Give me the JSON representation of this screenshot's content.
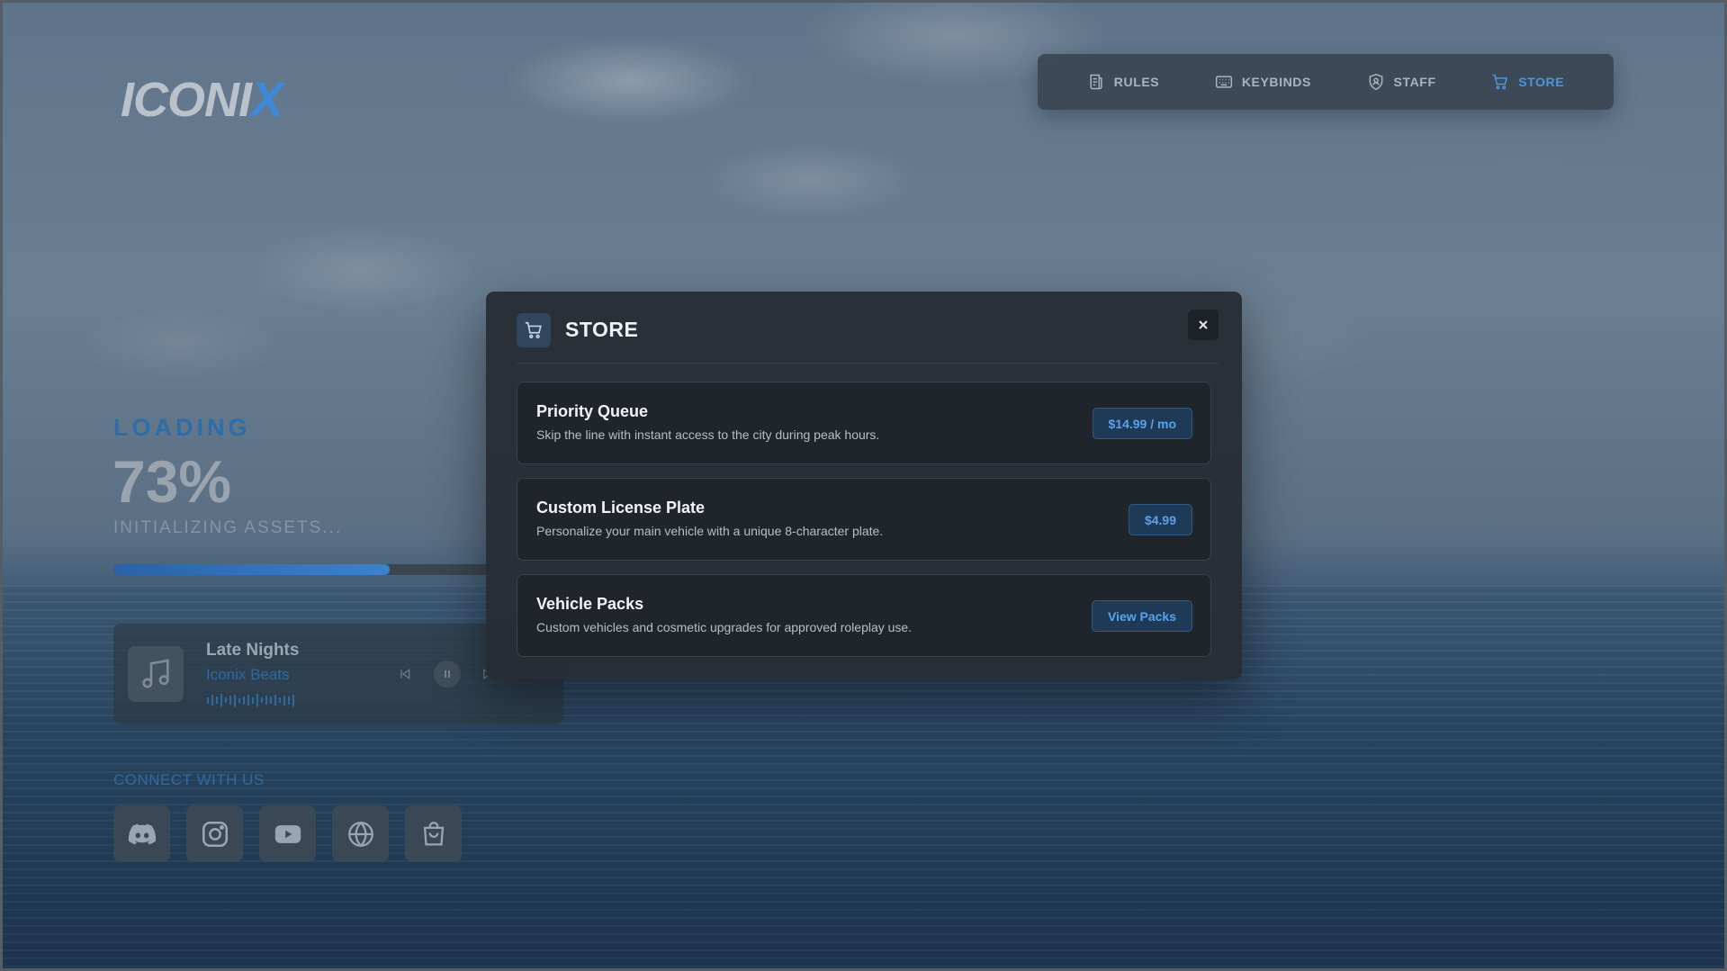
{
  "logo": {
    "text_main": "ICONI",
    "text_accent": "X"
  },
  "nav": {
    "items": [
      {
        "label": "RULES",
        "icon": "rules-icon"
      },
      {
        "label": "KEYBINDS",
        "icon": "keyboard-icon"
      },
      {
        "label": "STAFF",
        "icon": "shield-user-icon"
      },
      {
        "label": "STORE",
        "icon": "cart-icon",
        "active": true
      }
    ]
  },
  "loading": {
    "label": "LOADING",
    "percent_text": "73%",
    "status": "INITIALIZING ASSETS...",
    "progress": 0.73
  },
  "music": {
    "title": "Late Nights",
    "artist": "Iconix Beats",
    "icons": [
      "music-note-icon",
      "skip-back-icon",
      "pause-icon",
      "play-icon"
    ]
  },
  "connect": {
    "label": "CONNECT WITH US",
    "socials": [
      "discord-icon",
      "instagram-icon",
      "youtube-icon",
      "globe-icon",
      "shopping-bag-icon"
    ]
  },
  "store_modal": {
    "title": "STORE",
    "items": [
      {
        "name": "Priority Queue",
        "description": "Skip the line with instant access to the city during peak hours.",
        "button": "$14.99 / mo"
      },
      {
        "name": "Custom License Plate",
        "description": "Personalize your main vehicle with a unique 8-character plate.",
        "button": "$4.99"
      },
      {
        "name": "Vehicle Packs",
        "description": "Custom vehicles and cosmetic upgrades for approved roleplay use.",
        "button": "View Packs"
      }
    ]
  },
  "colors": {
    "accent": "#3d8ad8",
    "modal_bg": "#282d34",
    "button_bg": "#1f3a57"
  }
}
